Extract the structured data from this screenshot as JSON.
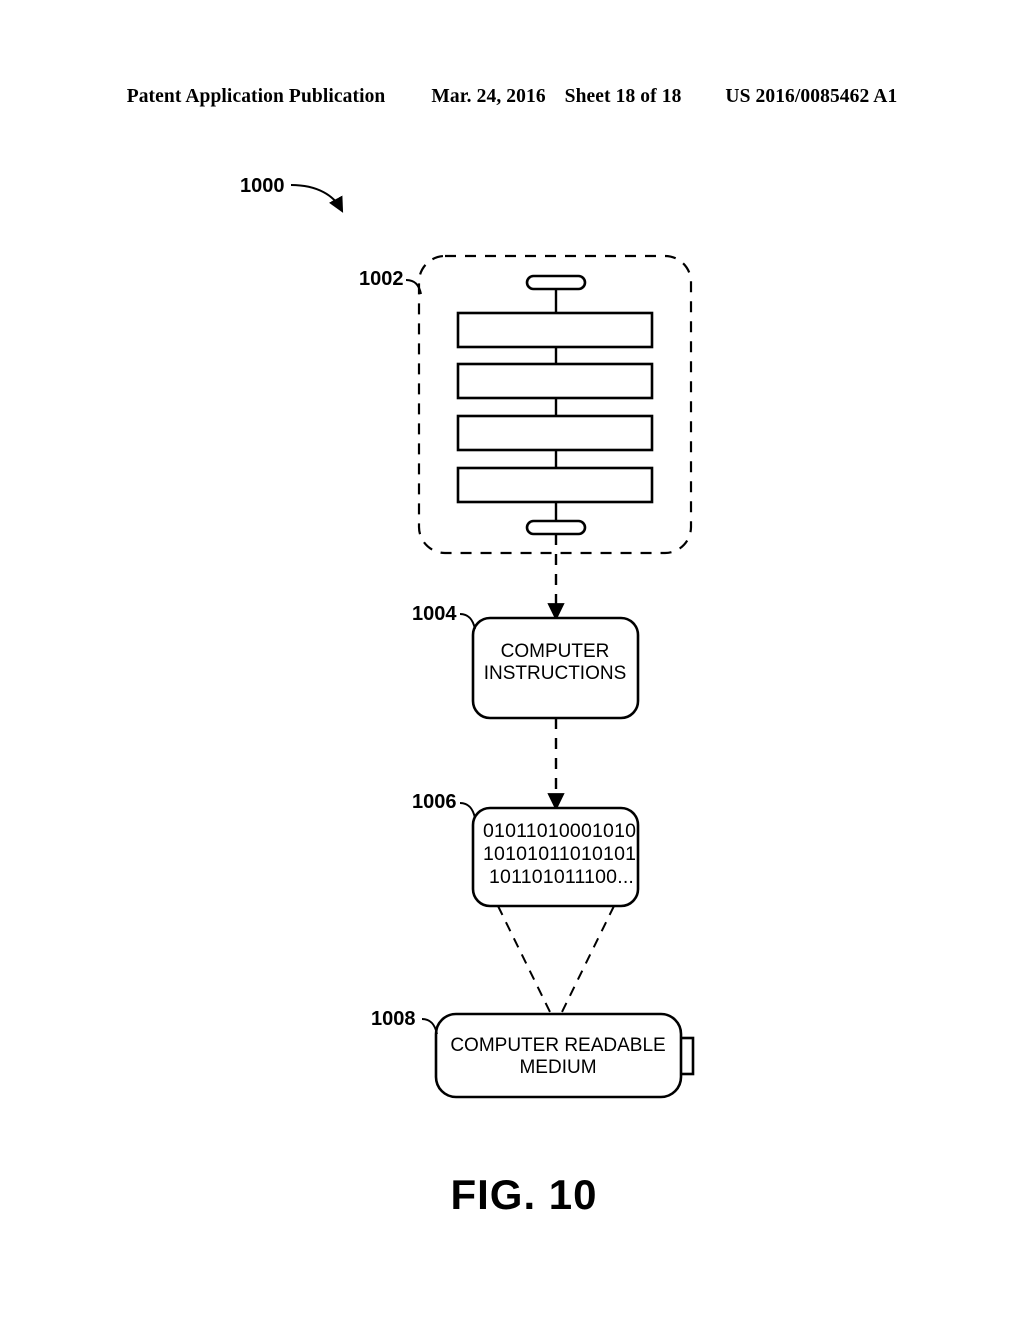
{
  "header": {
    "publication": "Patent Application Publication",
    "date": "Mar. 24, 2016",
    "sheet": "Sheet 18 of 18",
    "patent_number": "US 2016/0085462 A1"
  },
  "figure": {
    "caption": "FIG. 10",
    "overall_ref": "1000",
    "nodes": [
      {
        "ref": "1002",
        "type": "dashed-container",
        "label": "",
        "description": "flowchart-schematic"
      },
      {
        "ref": "1004",
        "type": "rounded-box",
        "label_line1": "COMPUTER",
        "label_line2": "INSTRUCTIONS"
      },
      {
        "ref": "1006",
        "type": "rounded-box",
        "binary_line1": "01011010001010",
        "binary_line2": "10101011010101",
        "binary_line3": "101101011100..."
      },
      {
        "ref": "1008",
        "type": "rounded-box-with-tab",
        "label_line1": "COMPUTER READABLE",
        "label_line2": "MEDIUM"
      }
    ]
  },
  "colors": {
    "ink": "#000000",
    "paper": "#ffffff"
  }
}
